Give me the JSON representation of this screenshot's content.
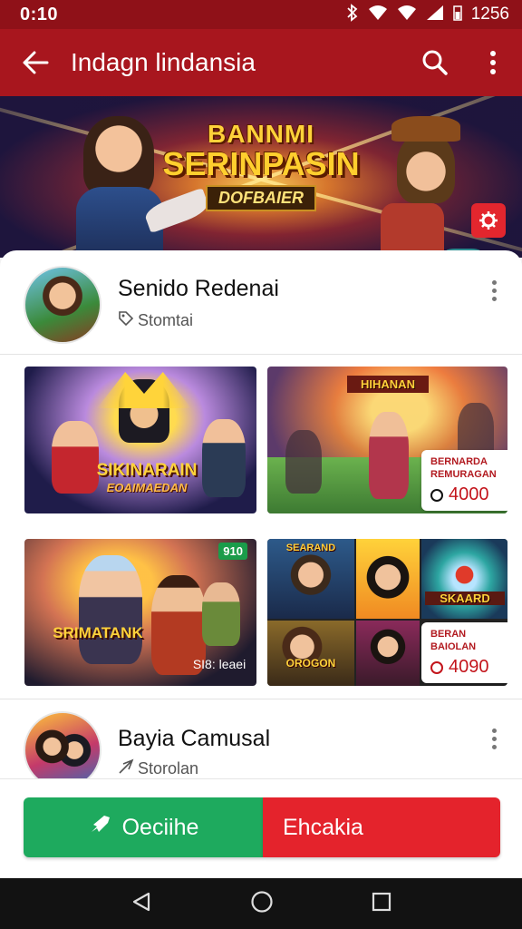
{
  "status_bar": {
    "time": "0:10",
    "right_text": "1256",
    "icons": [
      "bluetooth-icon",
      "wifi-icon",
      "signal-icon",
      "battery-icon"
    ]
  },
  "app_bar": {
    "title": "Indagn lindansia",
    "icons": [
      "back-arrow-icon",
      "search-icon",
      "more-vert-icon"
    ]
  },
  "hero": {
    "logo_line1": "BANNMI",
    "logo_line2": "SERINPASIN",
    "logo_line3": "DOFBAIER",
    "badge_icon": "settings-badge-icon"
  },
  "section1": {
    "title": "Senido Redenai",
    "subtitle": "Stomtai",
    "tiles": [
      {
        "text_line1": "SIKINARAIN",
        "text_line2": "EOAIMAEDAN"
      },
      {
        "text_top": "HIHANAN",
        "price_caption_1": "BERNARDA",
        "price_caption_2": "REMURAGAN",
        "price": "4000"
      },
      {
        "text_line1": "SRIMATANK",
        "corner_tag": "910",
        "footer_text": "SI8: leaei"
      },
      {
        "text_top": "SEARAND",
        "text_mid": "SKAARD",
        "text_low": "OROGON",
        "price_caption_1": "BERAN",
        "price_caption_2": "BAIOLAN",
        "price": "4090"
      }
    ]
  },
  "section2": {
    "title": "Bayia Camusal",
    "subtitle": "Storolan"
  },
  "actions": {
    "left_label": "Oeciihe",
    "right_label": "Ehcakia"
  },
  "colors": {
    "app_bar": "#a8161e",
    "status_bar": "#8f1118",
    "green_button": "#1eaa5e",
    "red_button": "#e4232c"
  }
}
